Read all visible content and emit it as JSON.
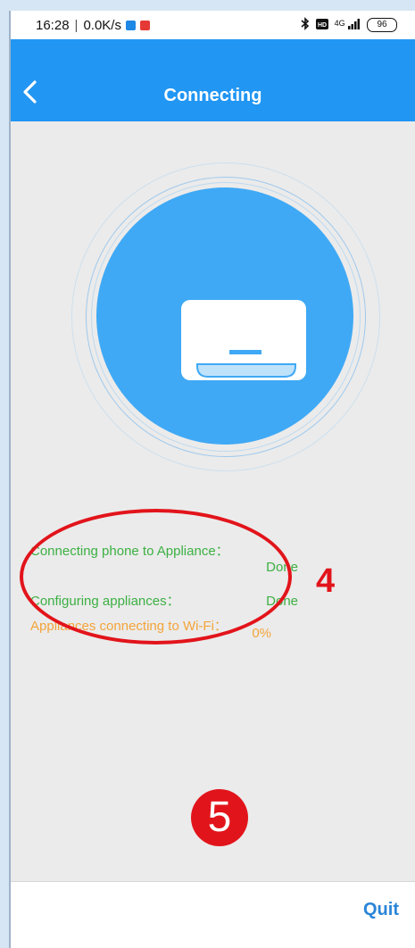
{
  "status_bar": {
    "time": "16:28",
    "separator": "|",
    "network_speed": "0.0K/s",
    "left_icons": [
      "app-notification-icon",
      "location-notification-icon"
    ],
    "right_icons": [
      "bluetooth-icon",
      "hd-icon",
      "signal-4g-icon"
    ],
    "network_label": "4G",
    "battery": "96"
  },
  "header": {
    "title": "Connecting",
    "back_icon": "chevron-left-icon",
    "color": "#2196f3"
  },
  "illustration": {
    "icon": "air-conditioner-icon",
    "circle_color": "#3fa9f5"
  },
  "steps": [
    {
      "label": "Connecting phone to Appliance：",
      "value": "Done",
      "color": "#3cb043"
    },
    {
      "label": "Configuring appliances：",
      "value": "Done",
      "color": "#3cb043"
    },
    {
      "label": "Appliances connecting to Wi-Fi：",
      "value": "0%",
      "color": "#f4a43a"
    }
  ],
  "annotations": {
    "step_marker": "4",
    "circle_marker": "5",
    "color": "#e2141b"
  },
  "footer": {
    "quit_label": "Quit"
  }
}
